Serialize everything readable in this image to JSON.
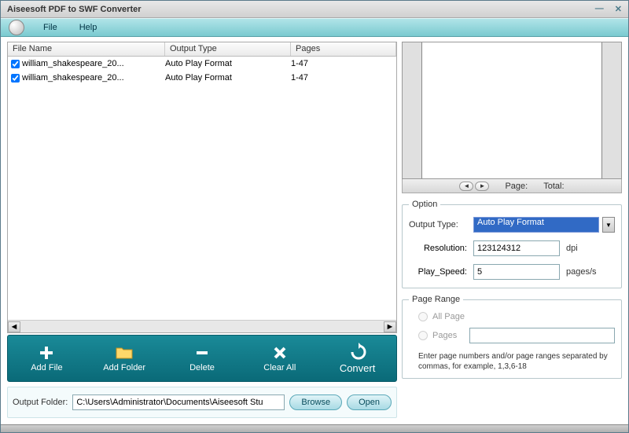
{
  "title": "Aiseesoft PDF to SWF Converter",
  "menu": {
    "file": "File",
    "help": "Help"
  },
  "table": {
    "headers": {
      "name": "File Name",
      "type": "Output Type",
      "pages": "Pages"
    },
    "rows": [
      {
        "name": "william_shakespeare_20...",
        "type": "Auto Play Format",
        "pages": "1-47"
      },
      {
        "name": "william_shakespeare_20...",
        "type": "Auto Play Format",
        "pages": "1-47"
      }
    ]
  },
  "toolbar": {
    "add_file": "Add File",
    "add_folder": "Add Folder",
    "delete": "Delete",
    "clear_all": "Clear All",
    "convert": "Convert"
  },
  "output": {
    "label": "Output Folder:",
    "path": "C:\\Users\\Administrator\\Documents\\Aiseesoft Stu",
    "browse": "Browse",
    "open": "Open"
  },
  "preview": {
    "page_label": "Page:",
    "total_label": "Total:"
  },
  "option": {
    "legend": "Option",
    "output_type_label": "Output Type:",
    "output_type_value": "Auto Play Format",
    "resolution_label": "Resolution:",
    "resolution_value": "123124312",
    "resolution_unit": "dpi",
    "play_speed_label": "Play_Speed:",
    "play_speed_value": "5",
    "play_speed_unit": "pages/s"
  },
  "page_range": {
    "legend": "Page Range",
    "all_page": "All Page",
    "pages": "Pages",
    "hint": "Enter page numbers and/or page ranges separated by commas, for example, 1,3,6-18"
  }
}
